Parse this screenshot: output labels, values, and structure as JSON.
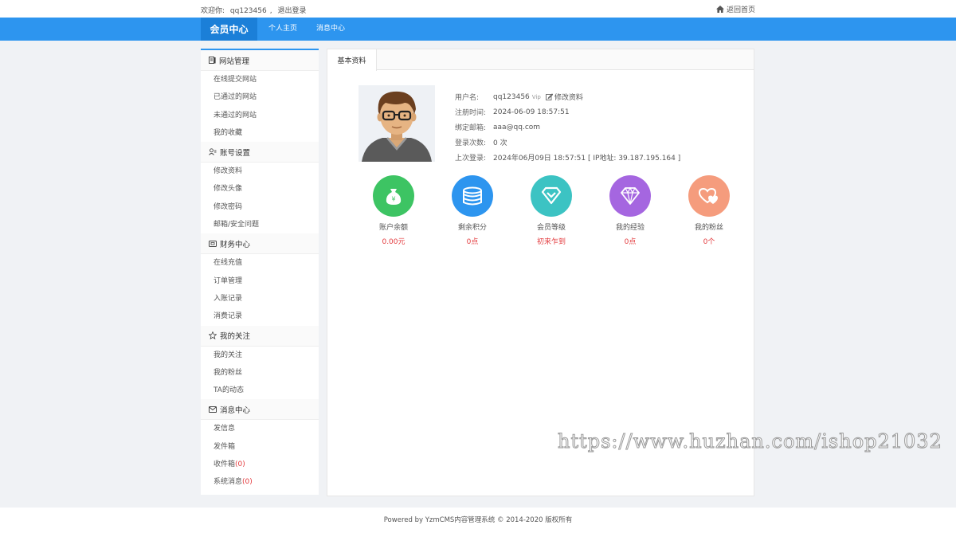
{
  "topbar": {
    "welcome_prefix": "欢迎你:",
    "username": "qq123456",
    "separator": ",",
    "logout": "退出登录",
    "home_link": "返回首页",
    "home_icon": "home-icon"
  },
  "nav": {
    "brand": "会员中心",
    "links": [
      "个人主页",
      "消息中心"
    ],
    "colors": {
      "bar": "#2d95ef",
      "brand_bg": "#1b7fd8"
    }
  },
  "sidebar": {
    "groups": [
      {
        "title": "网站管理",
        "icon": "document-icon",
        "items": [
          "在线提交网站",
          "已通过的网站",
          "未通过的网站",
          "我的收藏"
        ]
      },
      {
        "title": "账号设置",
        "icon": "users-icon",
        "items": [
          "修改资料",
          "修改头像",
          "修改密码",
          "邮箱/安全问题"
        ]
      },
      {
        "title": "财务中心",
        "icon": "wallet-icon",
        "items": [
          "在线充值",
          "订单管理",
          "入账记录",
          "消费记录"
        ]
      },
      {
        "title": "我的关注",
        "icon": "star-icon",
        "items": [
          "我的关注",
          "我的粉丝",
          "TA的动态"
        ]
      },
      {
        "title": "消息中心",
        "icon": "mail-icon",
        "items": [
          "发信息",
          "发件箱",
          "收件箱",
          "系统消息"
        ],
        "counts": [
          "(0)",
          "(0)"
        ]
      }
    ]
  },
  "panel": {
    "tab": "基本资料",
    "profile": {
      "username_label": "用户名:",
      "username": "qq123456",
      "vip": "Vip",
      "edit_link": "修改资料",
      "reg_label": "注册时间:",
      "reg_time": "2024-06-09 18:57:51",
      "email_label": "绑定邮箱:",
      "email": "aaa@qq.com",
      "login_count_label": "登录次数:",
      "login_count": "0 次",
      "last_login_label": "上次登录:",
      "last_login": "2024年06月09日 18:57:51 [ IP地址: 39.187.195.164 ]"
    },
    "stats": [
      {
        "label": "账户余额",
        "value": "0.00元",
        "color": "#3dc463",
        "icon": "money-bag-icon"
      },
      {
        "label": "剩余积分",
        "value": "0点",
        "color": "#2d95ef",
        "icon": "coins-icon"
      },
      {
        "label": "会员等级",
        "value": "初来乍到",
        "color": "#3cc3c3",
        "icon": "badge-icon"
      },
      {
        "label": "我的经验",
        "value": "0点",
        "color": "#a566e0",
        "icon": "diamond-icon"
      },
      {
        "label": "我的粉丝",
        "value": "0个",
        "color": "#f59c7d",
        "icon": "hearts-icon"
      }
    ]
  },
  "footer": "Powered by YzmCMS内容管理系统 © 2014-2020 版权所有",
  "watermark": "https://www.huzhan.com/ishop21032"
}
